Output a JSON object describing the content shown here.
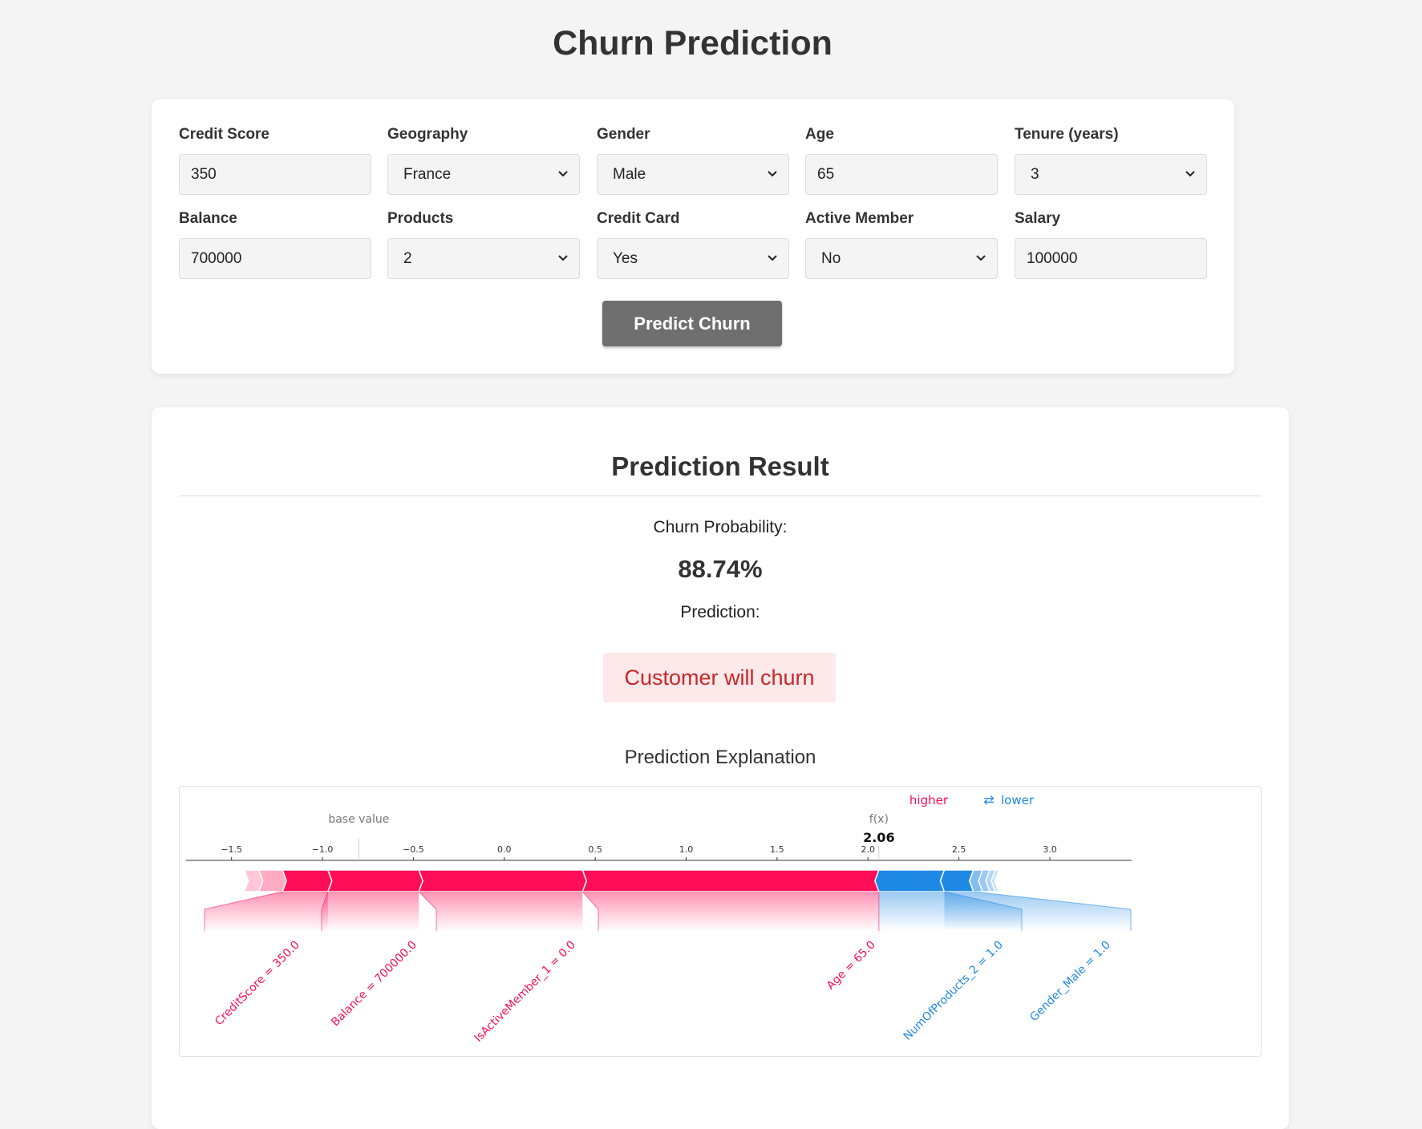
{
  "page": {
    "title": "Churn Prediction"
  },
  "form": {
    "fields": [
      {
        "label": "Credit Score",
        "type": "input",
        "value": "350"
      },
      {
        "label": "Geography",
        "type": "select",
        "value": "France"
      },
      {
        "label": "Gender",
        "type": "select",
        "value": "Male"
      },
      {
        "label": "Age",
        "type": "input",
        "value": "65"
      },
      {
        "label": "Tenure (years)",
        "type": "select",
        "value": "3"
      },
      {
        "label": "Balance",
        "type": "input",
        "value": "700000"
      },
      {
        "label": "Products",
        "type": "select",
        "value": "2"
      },
      {
        "label": "Credit Card",
        "type": "select",
        "value": "Yes"
      },
      {
        "label": "Active Member",
        "type": "select",
        "value": "No"
      },
      {
        "label": "Salary",
        "type": "input",
        "value": "100000"
      }
    ],
    "submit_label": "Predict Churn"
  },
  "result": {
    "title": "Prediction Result",
    "probability_label": "Churn Probability:",
    "probability_value": "88.74%",
    "prediction_label": "Prediction:",
    "prediction_text": "Customer will churn",
    "explanation_title": "Prediction Explanation"
  },
  "colors": {
    "positive": "#ff0d57",
    "negative": "#1e88e5",
    "button": "#6f6f6f",
    "badge_bg": "#fde8ea",
    "badge_text": "#c62828"
  },
  "chart_data": {
    "type": "force",
    "legend": {
      "higher": "higher",
      "arrow": "⇄",
      "lower": "lower"
    },
    "base_value_label": "base value",
    "fx_label": "f(x)",
    "fx_display": "2.06",
    "base_value": -0.8,
    "fx": 2.06,
    "xlim": [
      -1.75,
      3.45
    ],
    "ticks": [
      -1.5,
      -1.0,
      -0.5,
      0.0,
      0.5,
      1.0,
      1.5,
      2.0,
      2.5,
      3.0
    ],
    "tick_labels": [
      "−1.5",
      "−1.0",
      "−0.5",
      "0.0",
      "0.5",
      "1.0",
      "1.5",
      "2.0",
      "2.5",
      "3.0"
    ],
    "positive_features": [
      {
        "label": "CreditScore = 350.0",
        "from": -1.22,
        "to": -0.97
      },
      {
        "label": "Balance = 700000.0",
        "from": -0.97,
        "to": -0.47
      },
      {
        "label": "IsActiveMember_1 = 0.0",
        "from": -0.47,
        "to": 0.43
      },
      {
        "label": "Age = 65.0",
        "from": 0.43,
        "to": 2.06
      }
    ],
    "positive_small": [
      {
        "from": -1.35,
        "to": -1.22
      },
      {
        "from": -1.43,
        "to": -1.35
      }
    ],
    "negative_features": [
      {
        "label": "Age = 65.0",
        "from": 2.06,
        "to": 2.06
      },
      {
        "label": "NumOfProducts_2 = 1.0",
        "from": 2.06,
        "to": 2.42
      },
      {
        "label": "Gender_Male = 1.0",
        "from": 2.42,
        "to": 2.58
      }
    ],
    "negative_small": [
      {
        "from": 2.58,
        "to": 2.63
      },
      {
        "from": 2.63,
        "to": 2.67
      },
      {
        "from": 2.67,
        "to": 2.7
      },
      {
        "from": 2.7,
        "to": 2.72
      }
    ]
  }
}
